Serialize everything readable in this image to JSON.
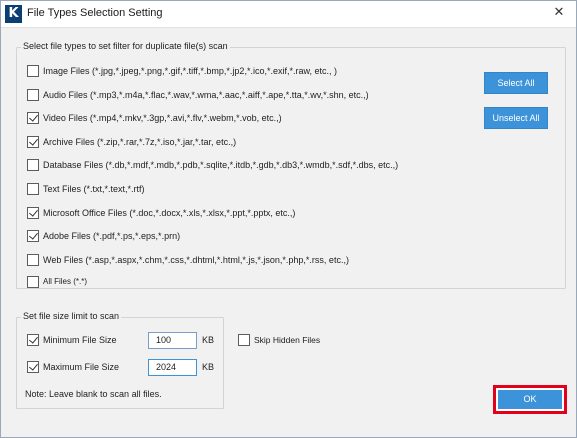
{
  "window": {
    "title": "File Types Selection Setting",
    "app_icon_letter": "K",
    "close_glyph": "✕"
  },
  "filetypes": {
    "legend": "Select file types to set filter for duplicate file(s) scan",
    "items": [
      {
        "label": "Image Files  (*.jpg,*.jpeg,*.png,*.gif,*.tiff,*.bmp,*.jp2,*.ico,*.exif,*.raw, etc., )",
        "checked": false
      },
      {
        "label": "Audio Files (*.mp3,*.m4a,*.flac,*.wav,*.wma,*.aac,*.aiff,*.ape,*.tta,*.wv,*.shn, etc.,)",
        "checked": false
      },
      {
        "label": "Video Files (*.mp4,*.mkv,*.3gp,*.avi,*.flv,*.webm,*.vob, etc.,)",
        "checked": true
      },
      {
        "label": "Archive Files (*.zip,*.rar,*.7z,*.iso,*.jar,*.tar, etc.,)",
        "checked": true
      },
      {
        "label": "Database Files (*.db,*.mdf,*.mdb,*.pdb,*.sqlite,*.itdb,*.gdb,*.db3,*.wmdb,*.sdf,*.dbs, etc.,)",
        "checked": false
      },
      {
        "label": "Text Files (*.txt,*.text,*.rtf)",
        "checked": false
      },
      {
        "label": "Microsoft Office Files (*.doc,*.docx,*.xls,*.xlsx,*.ppt,*.pptx, etc.,)",
        "checked": true
      },
      {
        "label": "Adobe Files (*.pdf,*.ps,*.eps,*.prn)",
        "checked": true
      },
      {
        "label": "Web Files (*.asp,*.aspx,*.chm,*.css,*.dhtml,*.html,*.js,*.json,*.php,*.rss, etc.,)",
        "checked": false
      },
      {
        "label": "All Files (*.*)",
        "checked": false
      }
    ],
    "select_all_label": "Select All",
    "unselect_all_label": "Unselect All"
  },
  "sizelimit": {
    "legend": "Set file size limit to scan",
    "min_label": "Minimum File Size",
    "min_checked": true,
    "min_value": "100",
    "max_label": "Maximum File Size",
    "max_checked": true,
    "max_value": "2024",
    "unit": "KB",
    "note": "Note: Leave blank to scan all files."
  },
  "skip_hidden": {
    "label": "Skip Hidden Files",
    "checked": false
  },
  "ok_label": "OK",
  "colors": {
    "accent": "#3d93d9",
    "highlight": "#e3001b",
    "title_icon": "#0b3f73"
  }
}
